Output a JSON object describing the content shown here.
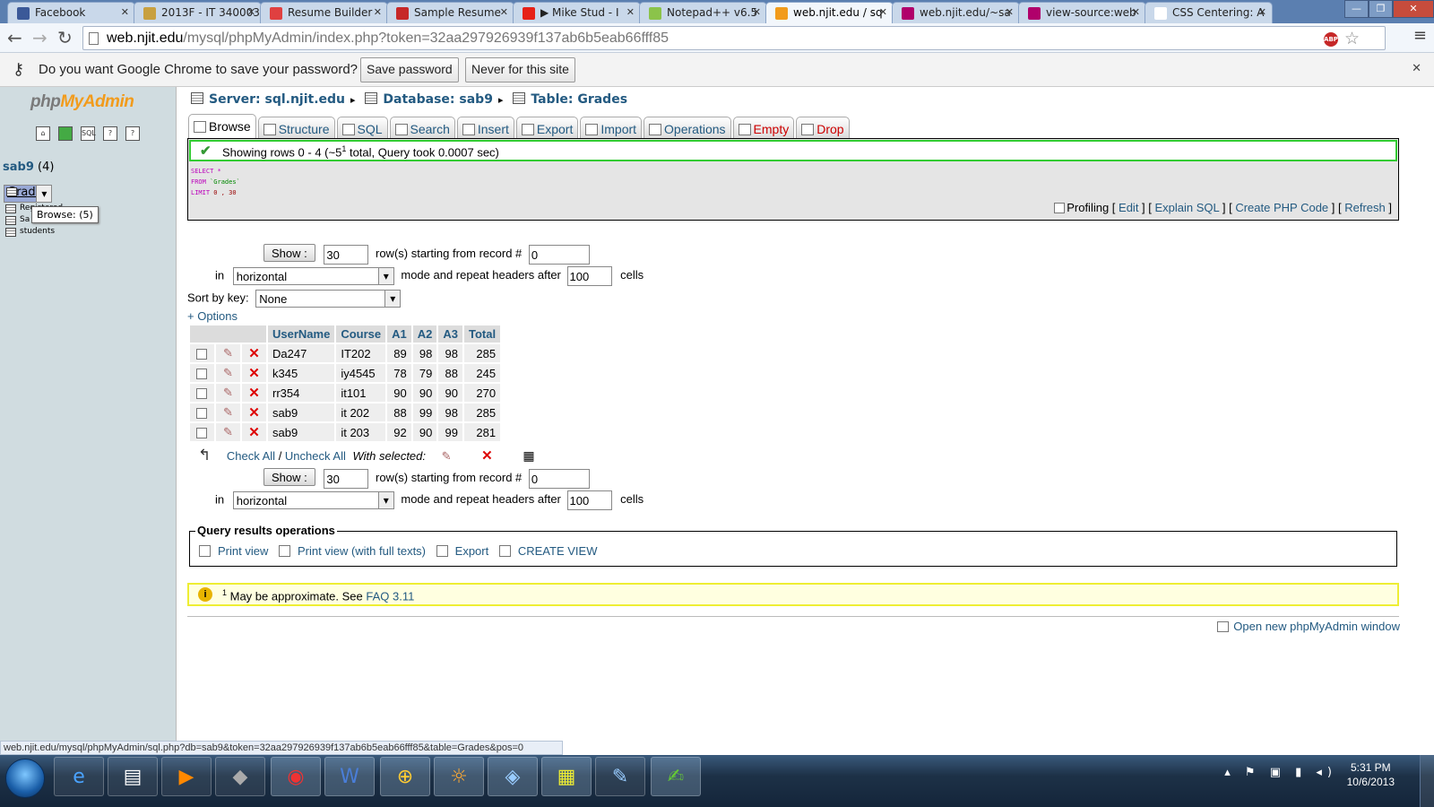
{
  "browser": {
    "tabs": [
      {
        "title": "Facebook",
        "icon_color": "#3b5998",
        "active": false
      },
      {
        "title": "2013F - IT 340003",
        "icon_color": "#c8a040",
        "active": false
      },
      {
        "title": "Resume Builder",
        "icon_color": "#e04040",
        "active": false
      },
      {
        "title": "Sample Resume",
        "icon_color": "#c62828",
        "active": false
      },
      {
        "title": "▶ Mike Stud - I",
        "icon_color": "#e62117",
        "active": false
      },
      {
        "title": "Notepad++ v6.5",
        "icon_color": "#8bc34a",
        "active": false
      },
      {
        "title": "web.njit.edu / sq",
        "icon_color": "#f29b1b",
        "active": true
      },
      {
        "title": "web.njit.edu/~sa",
        "icon_color": "#b0006b",
        "active": false
      },
      {
        "title": "view-source:web",
        "icon_color": "#b0006b",
        "active": false
      },
      {
        "title": "CSS Centering: A",
        "icon_color": "#ffffff",
        "active": false
      }
    ],
    "url_host": "web.njit.edu",
    "url_path": "/mysql/phpMyAdmin/index.php?token=32aa297926939f137ab6b5eab66fff85",
    "abp_label": "ABP",
    "infobar": {
      "message": "Do you want Google Chrome to save your password?",
      "save_label": "Save password",
      "never_label": "Never for this site"
    },
    "status_url": "web.njit.edu/mysql/phpMyAdmin/sql.php?db=sab9&token=32aa297926939f137ab6b5eab66fff85&table=Grades&pos=0"
  },
  "sidebar": {
    "logo_php": "php",
    "logo_myadmin": "MyAdmin",
    "db_name": "sab9",
    "db_count": "(4)",
    "tables": [
      "Grades",
      "Registered",
      "Sa",
      "students"
    ],
    "tooltip": "Browse: (5)"
  },
  "breadcrumb": {
    "server": "Server: sql.njit.edu",
    "database": "Database: sab9",
    "table": "Table: Grades"
  },
  "tabs": [
    "Browse",
    "Structure",
    "SQL",
    "Search",
    "Insert",
    "Export",
    "Import",
    "Operations",
    "Empty",
    "Drop"
  ],
  "result": {
    "success_pre": "Showing rows 0 - 4 (~5",
    "success_sup": "1",
    "success_post": " total, Query took 0.0007 sec)",
    "sql_select": "SELECT *",
    "sql_from_kw": "FROM",
    "sql_from_tbl": "`Grades`",
    "sql_limit_kw": "LIMIT",
    "sql_limit_val": "0 , 30",
    "profiling": "Profiling",
    "links": [
      "Edit",
      "Explain SQL",
      "Create PHP Code",
      "Refresh"
    ]
  },
  "nav": {
    "show_label": "Show :",
    "rows": "30",
    "rows_label": "row(s) starting from record #",
    "start": "0",
    "in_label": "in",
    "mode": "horizontal",
    "mode_label": "mode and repeat headers after",
    "repeat": "100",
    "cells_label": "cells"
  },
  "sortkey": {
    "label": "Sort by key:",
    "value": "None"
  },
  "options_label": "+ Options",
  "table": {
    "columns": [
      "UserName",
      "Course",
      "A1",
      "A2",
      "A3",
      "Total"
    ],
    "rows": [
      [
        "Da247",
        "IT202",
        "89",
        "98",
        "98",
        "285"
      ],
      [
        "k345",
        "iy4545",
        "78",
        "79",
        "88",
        "245"
      ],
      [
        "rr354",
        "it101",
        "90",
        "90",
        "90",
        "270"
      ],
      [
        "sab9",
        "it 202",
        "88",
        "99",
        "98",
        "285"
      ],
      [
        "sab9",
        "it 203",
        "92",
        "90",
        "99",
        "281"
      ]
    ]
  },
  "checkall": {
    "check": "Check All",
    "sep": " / ",
    "uncheck": "Uncheck All",
    "with_selected": "With selected:"
  },
  "query_ops": {
    "legend": "Query results operations",
    "links": [
      "Print view",
      "Print view (with full texts)",
      "Export",
      "CREATE VIEW"
    ]
  },
  "notice": {
    "sup": "1",
    "text": " May be approximate. See ",
    "link": "FAQ 3.11"
  },
  "new_window": "Open new phpMyAdmin window",
  "clock": {
    "time": "5:31 PM",
    "date": "10/6/2013"
  }
}
